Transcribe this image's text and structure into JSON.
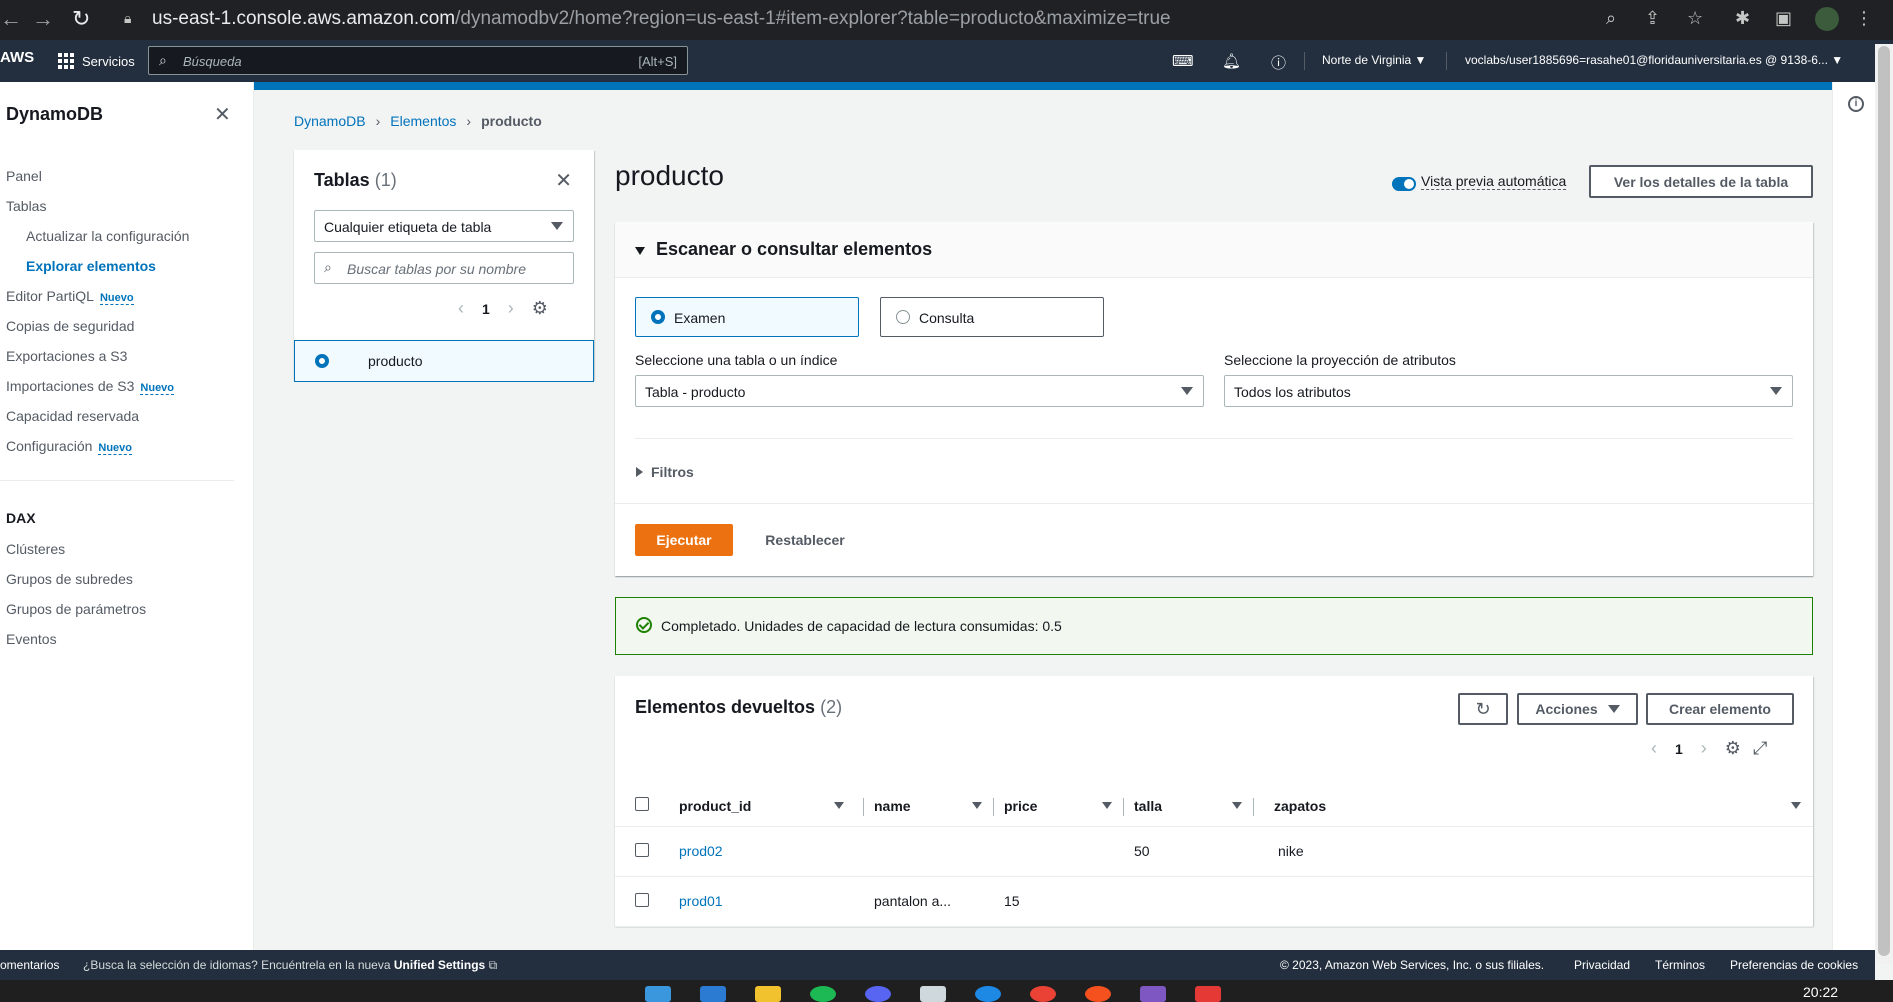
{
  "browser": {
    "url_host": "us-east-1.console.aws.amazon.com",
    "url_path": "/dynamodbv2/home?region=us-east-1#item-explorer?table=producto&maximize=true"
  },
  "awsnav": {
    "logo": "AWS",
    "services": "Servicios",
    "search_placeholder": "Búsqueda",
    "search_shortcut": "[Alt+S]",
    "region": "Norte de Virginia ▼",
    "account": "voclabs/user1885696=rasahe01@floridauniversitaria.es @ 9138-6... ▼"
  },
  "sidebar": {
    "title": "DynamoDB",
    "items": [
      {
        "label": "Panel"
      },
      {
        "label": "Tablas"
      },
      {
        "label": "Actualizar la configuración"
      },
      {
        "label": "Explorar elementos"
      },
      {
        "label": "Editor PartiQL",
        "badge": "Nuevo"
      },
      {
        "label": "Copias de seguridad"
      },
      {
        "label": "Exportaciones a S3"
      },
      {
        "label": "Importaciones de S3",
        "badge": "Nuevo"
      },
      {
        "label": "Capacidad reservada"
      },
      {
        "label": "Configuración",
        "badge": "Nuevo"
      }
    ],
    "dax_title": "DAX",
    "dax_items": [
      {
        "label": "Clústeres"
      },
      {
        "label": "Grupos de subredes"
      },
      {
        "label": "Grupos de parámetros"
      },
      {
        "label": "Eventos"
      }
    ]
  },
  "breadcrumb": {
    "items": [
      "DynamoDB",
      "Elementos"
    ],
    "current": "producto"
  },
  "tables_panel": {
    "title": "Tablas",
    "count": "(1)",
    "tag_filter": "Cualquier etiqueta de tabla",
    "search_placeholder": "Buscar tablas por su nombre",
    "page": "1",
    "selected_table": "producto"
  },
  "page": {
    "title": "producto",
    "auto_preview_label": "Vista previa automática",
    "details_button": "Ver los detalles de la tabla"
  },
  "scan": {
    "title": "Escanear o consultar elementos",
    "mode_scan": "Examen",
    "mode_query": "Consulta",
    "table_label": "Seleccione una tabla o un índice",
    "table_value": "Tabla - producto",
    "projection_label": "Seleccione la proyección de atributos",
    "projection_value": "Todos los atributos",
    "filters": "Filtros",
    "run": "Ejecutar",
    "reset": "Restablecer"
  },
  "success": {
    "message": "Completado. Unidades de capacidad de lectura consumidas: 0.5"
  },
  "items": {
    "title": "Elementos devueltos",
    "count": "(2)",
    "actions": "Acciones",
    "create": "Crear elemento",
    "page": "1",
    "columns": [
      "product_id",
      "name",
      "price",
      "talla",
      "zapatos"
    ],
    "rows": [
      {
        "product_id": "prod02",
        "name": "",
        "price": "",
        "talla": "50",
        "zapatos": "nike"
      },
      {
        "product_id": "prod01",
        "name": "pantalon a...",
        "price": "15",
        "talla": "",
        "zapatos": ""
      }
    ]
  },
  "footer": {
    "left": "omentarios",
    "lang_text": "¿Busca la selección de idiomas? Encuéntrela en la nueva",
    "lang_link": "Unified Settings",
    "copyright": "© 2023, Amazon Web Services, Inc. o sus filiales.",
    "privacy": "Privacidad",
    "terms": "Términos",
    "cookies": "Preferencias de cookies"
  },
  "taskbar": {
    "clock": "20:22"
  }
}
